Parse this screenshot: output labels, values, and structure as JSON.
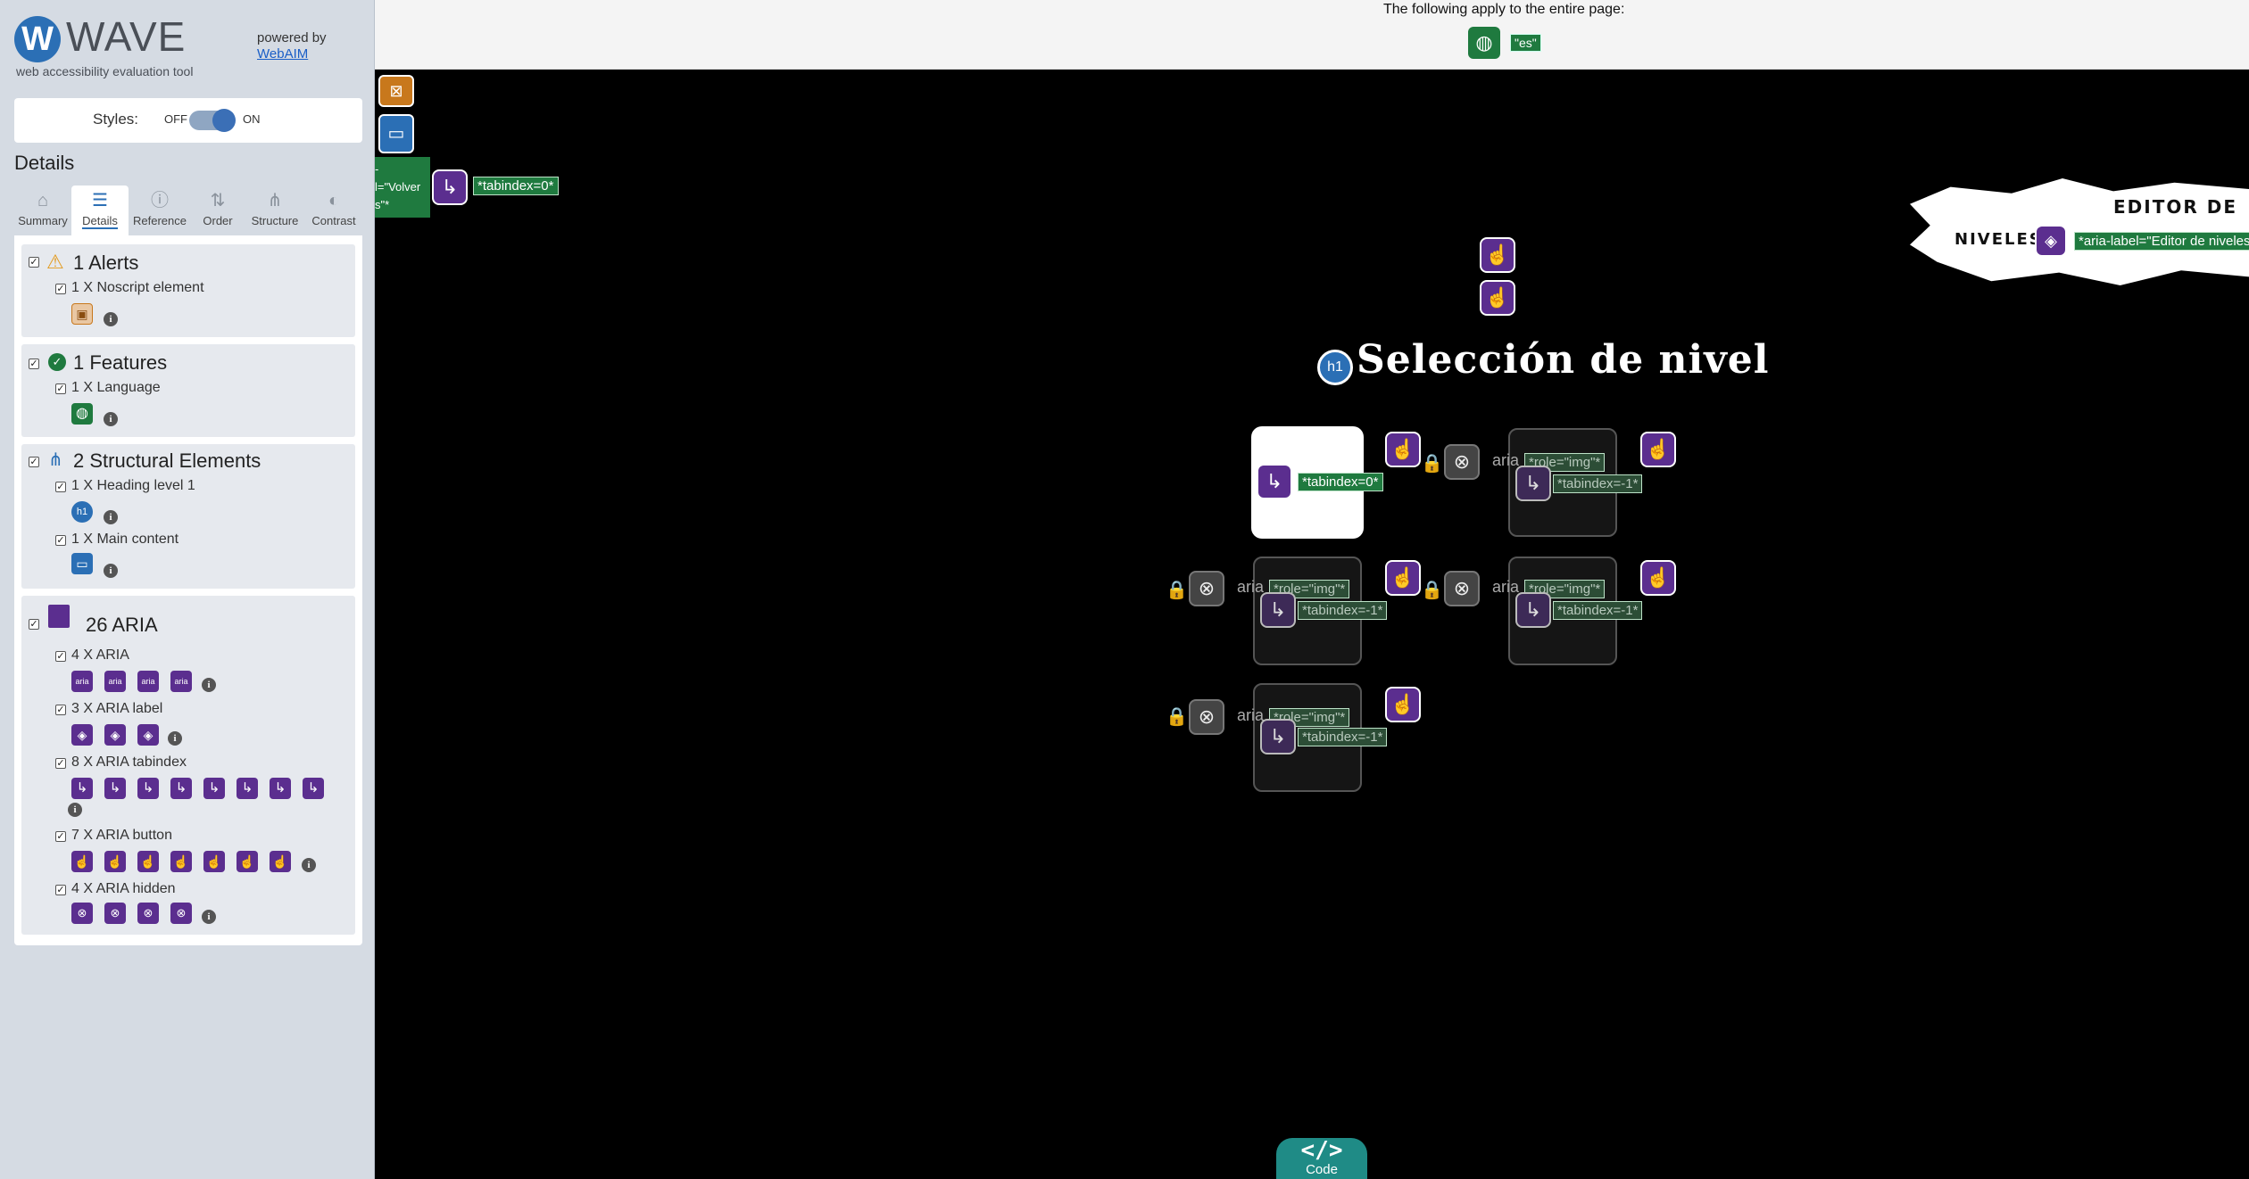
{
  "sidebar": {
    "brand": "WAVE",
    "brand_sub": "web accessibility evaluation tool",
    "powered_by": "powered by",
    "webaim_link": "WebAIM",
    "styles": {
      "label": "Styles:",
      "off": "OFF",
      "on": "ON",
      "state": "on"
    },
    "details_title": "Details",
    "tabs": [
      {
        "label": "Summary",
        "icon": "home-icon"
      },
      {
        "label": "Details",
        "icon": "list-icon",
        "active": true
      },
      {
        "label": "Reference",
        "icon": "info-icon"
      },
      {
        "label": "Order",
        "icon": "order-icon"
      },
      {
        "label": "Structure",
        "icon": "structure-icon"
      },
      {
        "label": "Contrast",
        "icon": "contrast-icon"
      }
    ],
    "sections": {
      "alerts": {
        "title": "1 Alerts",
        "items": [
          {
            "label": "1 X Noscript element",
            "icon": "noscript-icon"
          }
        ]
      },
      "features": {
        "title": "1 Features",
        "items": [
          {
            "label": "1 X Language",
            "icon": "language-icon"
          }
        ]
      },
      "structure": {
        "title": "2 Structural Elements",
        "items": [
          {
            "label": "1 X Heading level 1",
            "icon": "h1-icon",
            "icon_text": "h1"
          },
          {
            "label": "1 X Main content",
            "icon": "main-content-icon"
          }
        ]
      },
      "aria": {
        "title": "26 ARIA",
        "items": [
          {
            "label": "4 X ARIA",
            "count": 4,
            "icon_text": "aria"
          },
          {
            "label": "3 X ARIA label",
            "count": 3
          },
          {
            "label": "8 X ARIA tabindex",
            "count": 8
          },
          {
            "label": "7 X ARIA button",
            "count": 7
          },
          {
            "label": "4 X ARIA hidden",
            "count": 4
          }
        ]
      }
    }
  },
  "page": {
    "topbar_text": "The following apply to the entire page:",
    "lang_tag": "\"es\"",
    "back_tag_lines": [
      "-",
      "l=\"Volver",
      "s\"*"
    ],
    "back_tabindex_tag": "*tabindex=0*",
    "editor_title_line1": "EDITOR DE",
    "editor_title_line2": "NIVELES",
    "editor_aria_label": "*aria-label=\"Editor de niveles",
    "heading": "Selección de nivel",
    "heading_badge": "h1",
    "card_tabindex_active": "*tabindex=0*",
    "card_tabindex_locked": "*tabindex=-1*",
    "card_role": "*role=\"img\"*",
    "aria_text": "aria",
    "code_button": {
      "symbol": "</>",
      "label": "Code"
    }
  },
  "colors": {
    "wave_blue": "#2b6fb5",
    "aria_purple": "#5b2e8f",
    "feature_green": "#1f7a3f",
    "alert_orange": "#c8781c",
    "code_teal": "#1f8b86"
  }
}
